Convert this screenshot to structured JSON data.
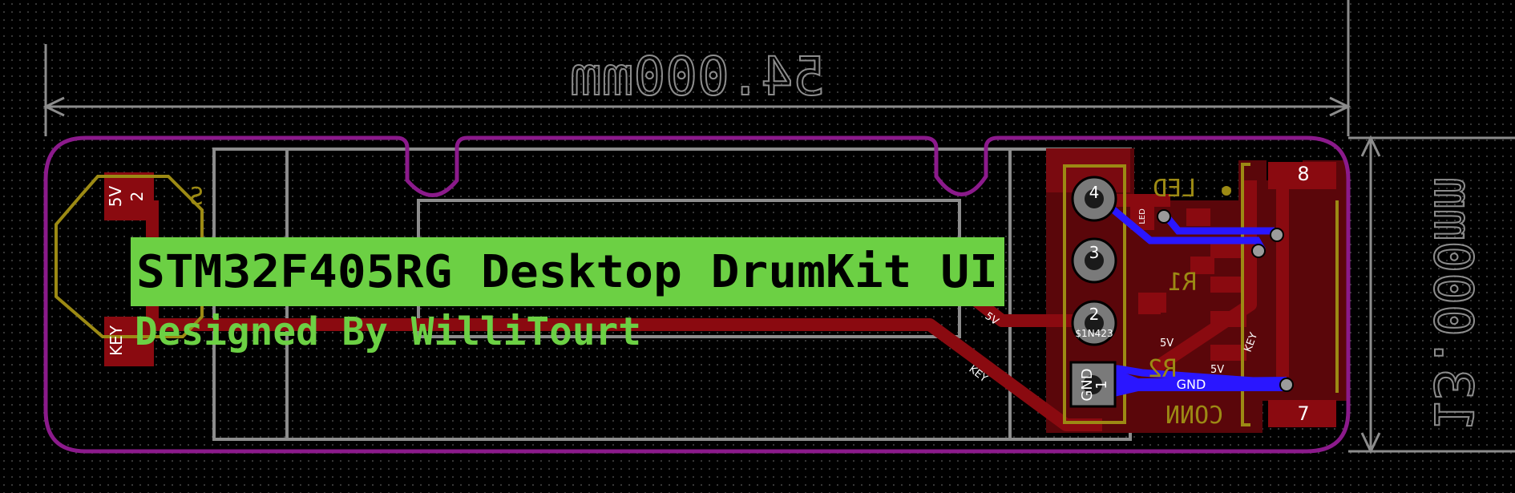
{
  "dimensions": {
    "width_label": "54.000mm",
    "height_label": "13.000mm"
  },
  "silkscreen": {
    "title": "STM32F405RG Desktop DrumKit UI",
    "subtitle": "Designed By WilliTourt"
  },
  "pads_left": {
    "top_label": "5V",
    "top_number": "2",
    "bottom_label": "KEY",
    "ref": "S"
  },
  "connector": {
    "pins": [
      {
        "number": "4"
      },
      {
        "number": "3"
      },
      {
        "number": "2",
        "text": "$1N423"
      },
      {
        "number": "1",
        "text": "GND"
      }
    ],
    "ref": "CONN"
  },
  "components": {
    "led_ref": "LED",
    "r1_ref": "R1",
    "r2_ref": "R2",
    "led_pad_text": "LED",
    "pin_top": "8",
    "pin_bottom": "7"
  },
  "nets": {
    "v5": "5V",
    "key": "KEY",
    "gnd": "GND"
  },
  "colors": {
    "board_outline": "#8b1a8b",
    "copper_top": "#8a0a10",
    "copper_bottom": "#2a16ff",
    "silkscreen": "#6cd044",
    "courtyard": "#9c8a14",
    "fab": "#8c8c8c"
  }
}
